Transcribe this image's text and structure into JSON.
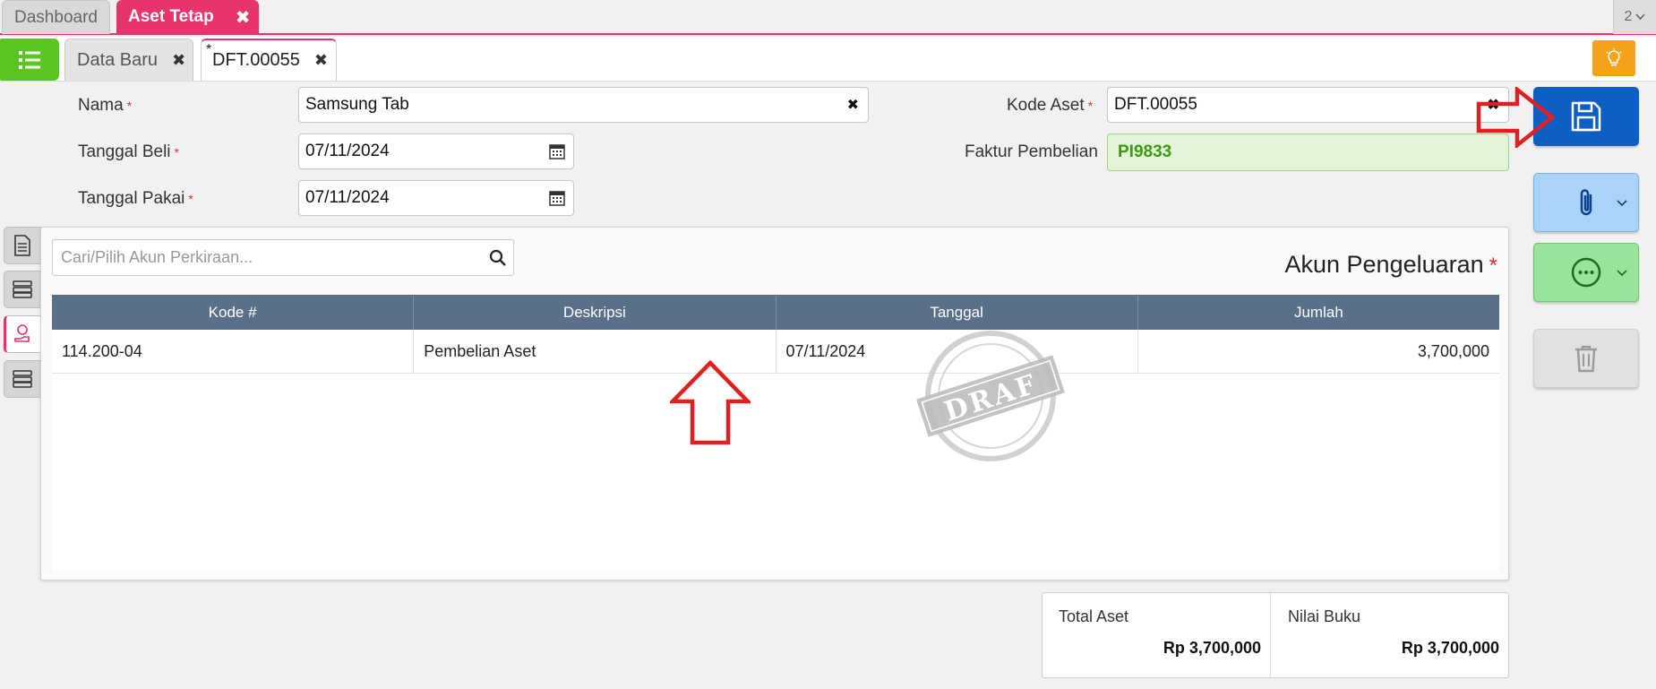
{
  "top_tabs": {
    "dashboard": "Dashboard",
    "aset_tetap": "Aset Tetap",
    "counter": "2"
  },
  "sub_tabs": {
    "data_baru": "Data Baru",
    "dft_marker": "*",
    "dft": "DFT.00055"
  },
  "form": {
    "nama_label": "Nama",
    "nama_value": "Samsung Tab",
    "tanggal_beli_label": "Tanggal Beli",
    "tanggal_beli_value": "07/11/2024",
    "tanggal_pakai_label": "Tanggal Pakai",
    "tanggal_pakai_value": "07/11/2024",
    "kode_aset_label": "Kode Aset",
    "kode_aset_value": "DFT.00055",
    "faktur_label": "Faktur Pembelian",
    "faktur_value": "PI9833",
    "required_mark": "*"
  },
  "panel": {
    "search_placeholder": "Cari/Pilih Akun Perkiraan...",
    "title": "Akun Pengeluaran",
    "columns": [
      "Kode #",
      "Deskripsi",
      "Tanggal",
      "Jumlah"
    ],
    "rows": [
      {
        "kode": "114.200-04",
        "deskripsi": "Pembelian Aset",
        "tanggal": "07/11/2024",
        "jumlah": "3,700,000"
      }
    ],
    "stamp_text": "DRAF"
  },
  "totals": {
    "total_aset_label": "Total Aset",
    "total_aset_value": "Rp 3,700,000",
    "nilai_buku_label": "Nilai Buku",
    "nilai_buku_value": "Rp 3,700,000"
  },
  "icons": {
    "menu": "list-icon",
    "idea": "lightbulb-icon",
    "save": "floppy-disk-icon",
    "attach": "paperclip-icon",
    "more": "more-options-icon",
    "delete": "trash-icon",
    "calendar": "calendar-icon",
    "search": "search-icon"
  },
  "colors": {
    "accent_pink": "#e8336b",
    "menu_green": "#5ac421",
    "save_blue": "#0d5fc4",
    "header_slate": "#5a6f88",
    "annotation_red": "#e02020"
  }
}
